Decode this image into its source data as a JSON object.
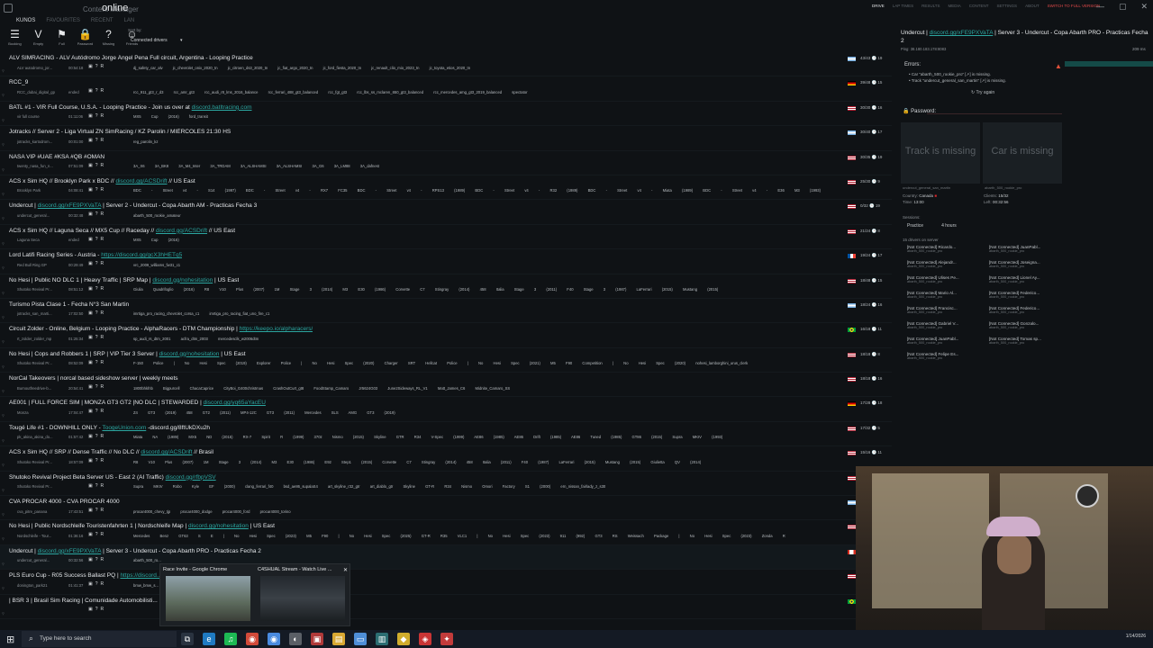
{
  "window": {
    "brand": "Content Manager",
    "title": "online",
    "topnav": [
      {
        "label": "DRIVE",
        "state": "active"
      },
      {
        "label": "LAP TIMES",
        "state": "normal"
      },
      {
        "label": "RESULTS",
        "state": "normal"
      },
      {
        "label": "MEDIA",
        "state": "normal"
      },
      {
        "label": "CONTENT",
        "state": "normal"
      },
      {
        "label": "SETTINGS",
        "state": "normal"
      },
      {
        "label": "ABOUT",
        "state": "normal"
      },
      {
        "label": "SWITCH TO FULL VERSION",
        "state": "highlight"
      }
    ],
    "controls": [
      "—",
      "▢",
      "✕"
    ]
  },
  "subtabs": [
    {
      "label": "KUNOS",
      "active": true
    },
    {
      "label": "FAVOURITES",
      "active": false
    },
    {
      "label": "RECENT",
      "active": false
    },
    {
      "label": "LAN",
      "active": false
    }
  ],
  "toolbar": {
    "tools": [
      {
        "icon": "hamburger-icon",
        "glyph": "☰",
        "label": "Booking"
      },
      {
        "icon": "chevron-down-icon",
        "glyph": "V",
        "label": "Empty"
      },
      {
        "icon": "flag-icon",
        "glyph": "⚑",
        "label": "Full"
      },
      {
        "icon": "lock-icon",
        "glyph": "🔒",
        "label": "Password"
      },
      {
        "icon": "question-icon",
        "glyph": "?",
        "label": "Missing"
      },
      {
        "icon": "friends-icon",
        "glyph": "☺",
        "label": "Friends"
      }
    ],
    "sort_label": "Sort by:",
    "sort_value": "Connected drivers",
    "sort_caret": "▾"
  },
  "servers": [
    {
      "name": "ALV SIMRACING - ALV Autódromo Jorge Ángel Pena Full circuit, Argentina - Looping Practice",
      "link": "",
      "suffix": "",
      "track": "ALV autodromo_jor...",
      "time": "00:54:18",
      "cars": "dj_safety_car_alv  jc_chevrolet_onix_2020_tn  jc_citroen_ds3_2020_tn  jc_fiat_argo_2020_tn  jc_ford_fiesta_2020_tn  jc_renault_clio_mio_2023_tn  jc_toyota_etios_2020_tn",
      "flag": "ar",
      "count": "43/43  🕒 19"
    },
    {
      "name": "RCC_9",
      "link": "",
      "suffix": "",
      "track": "RCC_dubai_digital_gp",
      "time": "ended",
      "cars": "rcc_911_gt3_r_d3  rcc_amr_gt3  rcc_audi_r8_lms_2016_balance  rcc_ferrari_488_gt3_balanced  rcc_fgt_gt3  rcc_lbs_ss_mclaren_650_gt3_balanced  rcc_mercedes_amg_gt3_2019_balanced  spectator",
      "flag": "de",
      "count": "39/48  🕒 15"
    },
    {
      "name": "BATL #1 - VIR Full Course, U.S.A. - Looping Practice - Join us over at ",
      "link": "discord.batltracing.com",
      "suffix": "",
      "track": "vir full course",
      "time": "01:11:06",
      "cars": "MX5 Cup (2016)  ford_transit",
      "flag": "us",
      "count": "30/30  🕒 16"
    },
    {
      "name": "Jotracks // Server 2 - Liga Virtual ZN SimRacing / KZ Parolin / MIÉRCOLES 21:30 HS",
      "link": "",
      "suffix": "",
      "track": "jotracks_kartodrom...",
      "time": "00:01:00",
      "cars": "reg_parolin_kz",
      "flag": "ar",
      "count": "30/40  🕒 17"
    },
    {
      "name": "NASA VIP #UAE #KSA #QB #OMAN",
      "link": "",
      "suffix": "",
      "track": "twenty_nasa_fun_n...",
      "time": "07:51:09",
      "cars": "3A_X6  3A_BK8  3A_M4_Inter  3A_TRDAM  3A_ALSHAMSI  3A_ALSHAMSI  3A_G6  3A_LM88  3A_dafnest",
      "flag": "us",
      "count": "30/35  🕒 19"
    },
    {
      "name": "ACS x Sim HQ // Brooklyn Park x BDC // ",
      "link": "discord.gg/ACSDrift",
      "suffix": " // US East",
      "track": "Brooklyn Park",
      "time": "04:08:41",
      "cars": "BDC - Street v4 - S14 (1997)  BDC - Street v4 - RX7 FC35  BDC - Street v4 - RPS13 (1989)  BDC - Street v4 - R32 (1989)  BDC - Street v4 - Miata (1989)  BDC - Street v4 - E36 M3 (1993)",
      "flag": "us",
      "count": "25/30  🕒 9"
    },
    {
      "name": "Undercut | ",
      "link": "discord.gg/xFE9PXVaTA",
      "suffix": " | Server 2 - Undercut - Copa Abarth AM - Practicas Fecha 3",
      "track": "undercut_general...",
      "time": "00:32:48",
      "cars": "abarth_500_rookie_amateur",
      "flag": "us",
      "count": "0/32  🕒 19"
    },
    {
      "name": "ACS x Sim HQ // Laguna Seca // MX5 Cup // Raceday // ",
      "link": "discord.gg/ACSDrift",
      "suffix": " // US East",
      "track": "Laguna Seca",
      "time": "ended",
      "cars": "MX5 Cup (2016)",
      "flag": "us",
      "count": "21/24  🕒 8"
    },
    {
      "name": "Lord Latifi Racing Series - Austria - ",
      "link": "https://discord.gg/gcX3hHETq5",
      "suffix": "",
      "track": "Red Bull Ring GP",
      "time": "00:29:49",
      "cars": "vrc_2009_williams_fw31_c1",
      "flag": "fr",
      "count": "19/24  🕒 17"
    },
    {
      "name": "No Hesi | Public NO DLC 1 | Heavy Traffic | SRP Map | ",
      "link": "discord.gg/nohesitation",
      "suffix": " | US East",
      "track": "Shutoko Revival Pr...",
      "time": "08:51:12",
      "cars": "Giulia Quadrifoglio (2016)  R8 V10 Plus (2007)  1M Stage 3 (2014)  M3 E30 (1986)  Corvette C7 Stingray (2014)  458 Italia Stage 3 (2011)  F40 Stage 3 (1987)  LaFerrari (2015)  Mustang (2015)",
      "flag": "us",
      "count": "18/48  🕒 15"
    },
    {
      "name": "Turismo Pista Clase 1 - Fecha N°3 San Martin",
      "link": "",
      "suffix": "",
      "track": "jotracks_san_marti...",
      "time": "17:02:50",
      "cars": "imrtiga_pro_racing_chevrolet_corsa_c1  imrtiga_pro_racing_fiat_uno_fire_c1",
      "flag": "ar",
      "count": "18/24  🕒 16"
    },
    {
      "name": "Circuit Zolder - Online, Belgium - Looping Practice - AlphaRacers - DTM Championship | ",
      "link": "https://keepo.io/alpharacers/",
      "suffix": "",
      "track": "rt_zolder_zolder_mp",
      "time": "01:25:34",
      "cars": "sp_audi_rs_dtm_2001  acfra_dtm_2003  mercedesclk_w2006dtm",
      "flag": "br",
      "count": "16/18  🕒 11"
    },
    {
      "name": "No Hesi | Cops and Robbers 1 | SRP | VIP Tier 3 Server | ",
      "link": "discord.gg/nohesitation",
      "suffix": " | US East",
      "track": "Shutoko Revival Pr...",
      "time": "08:52:09",
      "cars": "F-150 Police | No Hesi Spec (2019)  Explorer Police | No Hesi Spec (2020)  Charger SRT Hellcat Police | No Hesi Spec (2021)  M5 F90 Competition | No Hesi Spec (2020)  nohesi_lamborghini_urus_clerk",
      "flag": "us",
      "count": "18/18  🕒 8"
    },
    {
      "name": "NorCal Takeovers | norcal based sideshow server | weekly meets",
      "link": "",
      "suffix": "",
      "track": "Burnoutfreedrive-b...",
      "time": "20:54:41",
      "cars": "1800bhkfnb  Bigpurcell  ChacaCaprice  CityBoi_G400christmas  CrashOutCurt_gt8  FoodStamp_Camaro  Jr5624G03  June2Sideways_RL_V1  Matt_James_C6  Midnite_Camaro_SS",
      "flag": "us",
      "count": "18/18  🕒 16"
    },
    {
      "name": "AE001 | FULL FORCE SIM | MONZA GT3 GT2 |NO DLC | STEWARDED | ",
      "link": "discord.gg/yq65aYacEU",
      "suffix": "",
      "track": "Monza",
      "time": "17:04:47",
      "cars": "Z4 GT3 (2019)  458 GT2 (2011)  MP4-12C GT3 (2011)  Mercedes SLS AMG GT3 (2019)",
      "flag": "de",
      "count": "17/28  🕒 18"
    },
    {
      "name": "Tougé Life #1 - DOWNHILL ONLY - ",
      "link": "ToogeUnion.com",
      "suffix": " -discord.gg/8ftUkDXu2h",
      "track": "pk_akina_akina_do...",
      "time": "01:57:42",
      "cars": "Miata NA (1989)  MX5 ND (2015)  RX-7 Spirit R (1999)  370z Nismo (2015)  Skyline GTR R34 V-Spec (1999)  AE86 (1985)  AE86 Drift (1985)  AE86 Tuned (1985)  GT86 (2015)  Supra MKIV (1993)",
      "flag": "us",
      "count": "17/32  🕒 5"
    },
    {
      "name": "ACS x Sim HQ // SRP // Dense Traffic // No DLC // ",
      "link": "discord.gg/ACSDrift",
      "suffix": " // Brasil",
      "track": "Shutoko Revival Pr...",
      "time": "18:57:09",
      "cars": "R8 V10 Plus (2007)  1M Stage 3 (2014)  M3 E30 (1986)  E92 Step1 (2015)  Corvette C7 Stingray (2014)  458 Italia (2011)  F40 (1987)  LaFerrari (2015)  Mustang (2015)  Giulietta QV (2014)",
      "flag": "us",
      "count": "15/16  🕒 11"
    },
    {
      "name": "Shutoko Revival Project Beta Server US - East 2 (AI Traffic) ",
      "link": "discord.gg/rfbpVSV",
      "suffix": "",
      "track": "Shutoko Revival Pr...",
      "time": "",
      "cars": "Supra MKIV Robo Kyle EF (2000)  clang_ferrari_f40  bsd_ae86_supalaS4  art_skyline_r32_gtr  art_diablo_gtr  Skyline GT-R R34 Nismo Omori Factory S1 (2000)  ern_nissan_fairlady_z_s30",
      "flag": "us",
      "count": "15/45  🕒 12"
    },
    {
      "name": "CVA PROCAR 4000 - CVA PROCAR 4000",
      "link": "",
      "suffix": "",
      "track": "cva_pitre_panana",
      "time": "17:43:51",
      "cars": "procar4000_chevy_tjp  procar4000_dodge  procar4000_ford  procar4000_torino",
      "flag": "ar",
      "count": "14/18  🕒 15"
    },
    {
      "name": "No Hesi | Public Nordschleife Touristenfahrten 1 | Nordschleife Map | ",
      "link": "discord.gg/nohesitation",
      "suffix": " | US East",
      "track": "Nordschleife - Tour...",
      "time": "01:36:16",
      "cars": "Mercedes Benz GT63 S E | No Hesi Spec (2023)  M5 F90 | No Hesi Spec (2025)  GT-R R35 VLC1 | No Hesi Spec (2023)  911 (992) GT3 RS Weissach Package | No Hesi Spec (2023)  Zonda R",
      "flag": "us",
      "count": "14/16  🕒 13"
    },
    {
      "name": "Undercut | ",
      "link": "discord.gg/xFE9PXVaTA",
      "suffix": " | Server 3 - Undercut - Copa Abarth PRO - Practicas Fecha 2",
      "track": "undercut_general...",
      "time": "00:32:56",
      "cars": "abarth_500_ro...",
      "flag": "ca",
      "count": "",
      "selected": true
    },
    {
      "name": "PLS Euro Cup - R05 Success Ballast PQ | ",
      "link": "https://discord...",
      "suffix": "",
      "track": "donington_park21",
      "time": "01:41:37",
      "cars": "bmw_bmw_s...",
      "flag": "us",
      "count": ""
    },
    {
      "name": "| BSR 3 | Brasil Sim Racing | Comunidade Automobilisti...",
      "link": "",
      "suffix": "",
      "track": "",
      "time": "",
      "cars": "",
      "flag": "br",
      "count": ""
    }
  ],
  "detail": {
    "title_prefix": "Undercut | ",
    "title_link": "discord.gg/xFE9PXVaTA",
    "title_suffix": " | Server 3 - Undercut - Copa Abarth PRO - Practicas Fecha 2",
    "address": "Ping: 38.180.183.178:8083",
    "ping": "209 ms",
    "errors_label": "Errors:",
    "errors": [
      "• Car \"abarth_500_rookie_pro\" [↗] is missing.",
      "• Track \"undercut_general_san_martin\" [↗] is missing."
    ],
    "try_again": "↻ Try again",
    "password_label": "🔒 Password:",
    "track_missing": "Track is missing",
    "car_missing": "Car is missing",
    "track_caption": "undercut_general_san_martin",
    "car_caption": "abarth_500_rookie_pro",
    "country_label": "Country:",
    "country_value": "Canada",
    "time_label": "Time:",
    "time_value": "13:00",
    "clients_label": "Clients:",
    "clients_value": "15/32",
    "left_label": "Left:",
    "left_value": "00:32:56",
    "sessions_label": "Sessions:",
    "session_name": "Practice",
    "session_duration": "4 hours",
    "drivers_label": "15 drivers on server",
    "drivers": [
      {
        "name": "[Not Connected] Ricardo...",
        "car": "abarth_500_rookie_pro"
      },
      {
        "name": "[Not Connected] JuanPabl...",
        "car": "abarth_500_rookie_pro"
      },
      {
        "name": "[Not Connected] Alejandr...",
        "car": "abarth_500_rookie_pro"
      },
      {
        "name": "[Not Connected] Joseigna...",
        "car": "abarth_500_rookie_pro"
      },
      {
        "name": "[Not Connected] Ulises Pe...",
        "car": "abarth_500_rookie_pro"
      },
      {
        "name": "[Not Connected] Lionel Ay...",
        "car": "abarth_500_rookie_pro"
      },
      {
        "name": "[Not Connected] Mario Al...",
        "car": "abarth_500_rookie_pro"
      },
      {
        "name": "[Not Connected] Federico...",
        "car": "abarth_500_rookie_pro"
      },
      {
        "name": "[Not Connected] Francisc...",
        "car": "abarth_500_rookie_pro"
      },
      {
        "name": "[Not Connected] Federico...",
        "car": "abarth_500_rookie_pro"
      },
      {
        "name": "[Not Connected] Gabriel V...",
        "car": "abarth_500_rookie_pro"
      },
      {
        "name": "[Not Connected] Gonzalo...",
        "car": "abarth_500_rookie_pro"
      },
      {
        "name": "[Not Connected] JuanPabl...",
        "car": "abarth_500_rookie_pro"
      },
      {
        "name": "[Not Connected] Tomas sp...",
        "car": "abarth_500_rookie_pro"
      },
      {
        "name": "[Not Connected] Felipe Es...",
        "car": "abarth_500_rookie_pro"
      }
    ]
  },
  "thumbnails": [
    {
      "title": "Race Invite - Google Chrome",
      "icon": "chrome-icon"
    },
    {
      "title": "C4SHUAL Stream - Watch Live ...",
      "icon": "opera-icon"
    }
  ],
  "taskbar": {
    "start_glyph": "⊞",
    "search_placeholder": "Type here to search",
    "date": "1/14/2026",
    "apps": [
      {
        "icon": "task-view-icon",
        "glyph": "⧉",
        "color": "#2a3340"
      },
      {
        "icon": "edge-icon",
        "glyph": "e",
        "color": "#1f7ac2"
      },
      {
        "icon": "spotify-icon",
        "glyph": "♫",
        "color": "#1db954"
      },
      {
        "icon": "chrome-icon",
        "glyph": "◉",
        "color": "#d24a3a"
      },
      {
        "icon": "chrome-alt-icon",
        "glyph": "◉",
        "color": "#4a8be0"
      },
      {
        "icon": "obs-icon",
        "glyph": "◐",
        "color": "#5a5f66"
      },
      {
        "icon": "app-icon",
        "glyph": "▣",
        "color": "#b03a3a"
      },
      {
        "icon": "file-explorer-icon",
        "glyph": "▤",
        "color": "#d9a933"
      },
      {
        "icon": "notepad-icon",
        "glyph": "▭",
        "color": "#4f8fd8"
      },
      {
        "icon": "terminal-icon",
        "glyph": "▥",
        "color": "#2c6e73"
      },
      {
        "icon": "assetto-icon",
        "glyph": "◆",
        "color": "#d0ad2d"
      },
      {
        "icon": "game-icon",
        "glyph": "◈",
        "color": "#c93535"
      },
      {
        "icon": "tool-icon",
        "glyph": "✦",
        "color": "#c23b3b"
      }
    ]
  },
  "colors": {
    "accent": "#2ba6a0",
    "error": "#e24a4a",
    "background": "#0f1215"
  }
}
